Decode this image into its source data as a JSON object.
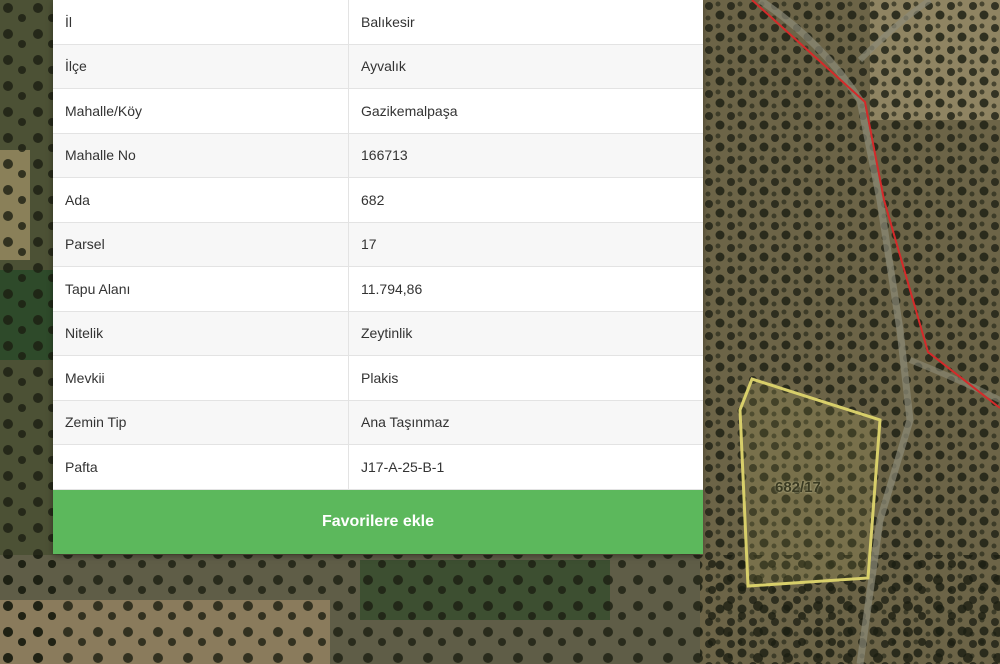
{
  "parcel_info": {
    "rows": [
      {
        "key": "İl",
        "value": "Balıkesir"
      },
      {
        "key": "İlçe",
        "value": "Ayvalık"
      },
      {
        "key": "Mahalle/Köy",
        "value": "Gazikemalpaşa"
      },
      {
        "key": "Mahalle No",
        "value": "166713"
      },
      {
        "key": "Ada",
        "value": "682"
      },
      {
        "key": "Parsel",
        "value": "17"
      },
      {
        "key": "Tapu Alanı",
        "value": "11.794,86"
      },
      {
        "key": "Nitelik",
        "value": "Zeytinlik"
      },
      {
        "key": "Mevkii",
        "value": "Plakis"
      },
      {
        "key": "Zemin Tip",
        "value": "Ana Taşınmaz"
      },
      {
        "key": "Pafta",
        "value": "J17-A-25-B-1"
      }
    ],
    "favorite_button_label": "Favorilere ekle"
  },
  "map": {
    "parcel_label": "682/17",
    "parcel_outline_color": "#d8cf6a",
    "boundary_color": "#d42a2a"
  },
  "colors": {
    "button": "#5cb85c"
  }
}
